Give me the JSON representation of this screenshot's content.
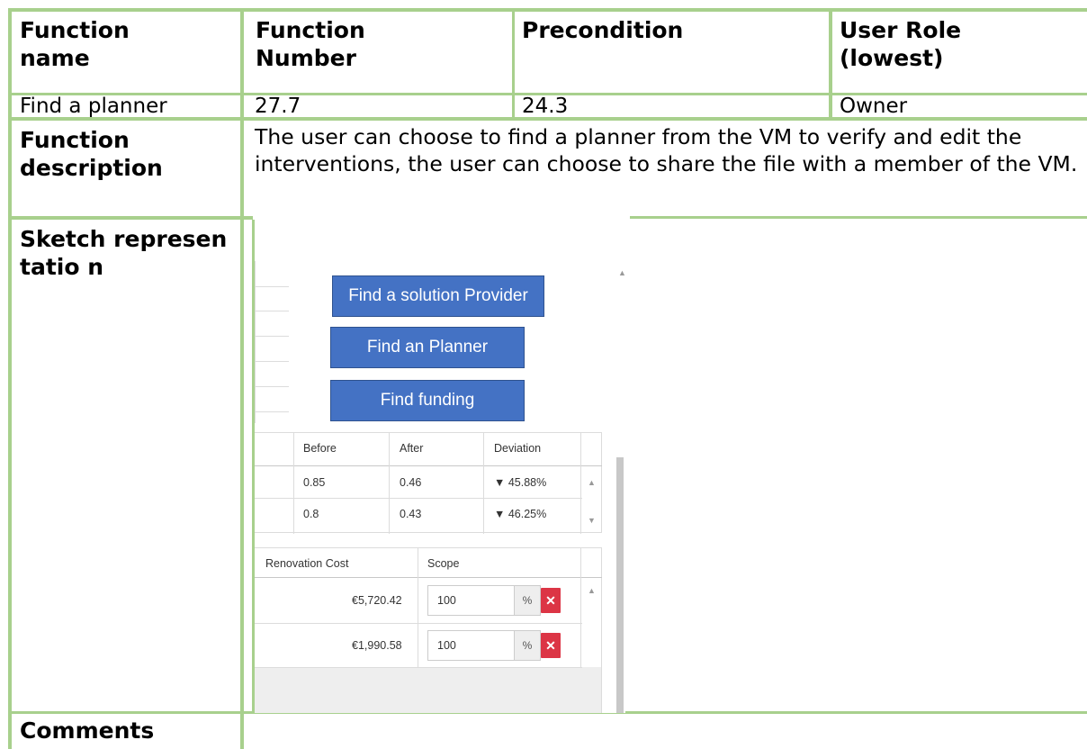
{
  "table": {
    "header": {
      "function_name": "Function name",
      "function_number": "Function Number",
      "precondition": "Precondition",
      "user_role": "User Role (lowest)"
    },
    "row": {
      "function_name": "Find a planner",
      "function_number": "27.7",
      "precondition": "24.3",
      "user_role": "Owner"
    },
    "description_label": "Function description",
    "description_text": "The user can choose to find a planner from the VM to verify and edit the interventions, the user can choose to share the file with a member of the VM.",
    "sketch_label": "Sketch representatio n",
    "comments_label": "Comments"
  },
  "sketch": {
    "buttons": {
      "solution_provider": "Find a solution Provider",
      "planner": "Find an Planner",
      "funding": "Find funding"
    },
    "deviation_table": {
      "headers": [
        "Before",
        "After",
        "Deviation"
      ],
      "rows": [
        {
          "before": "0.85",
          "after": "0.46",
          "deviation": "▼ 45.88%"
        },
        {
          "before": "0.8",
          "after": "0.43",
          "deviation": "▼ 46.25%"
        }
      ]
    },
    "cost_table": {
      "headers": [
        "Renovation Cost",
        "Scope"
      ],
      "rows": [
        {
          "cost": "€5,720.42",
          "scope": "100",
          "unit": "%"
        },
        {
          "cost": "€1,990.58",
          "scope": "100",
          "unit": "%"
        }
      ]
    },
    "colors": {
      "button_blue": "#4472c4",
      "delete_red": "#dc3545",
      "table_border_green": "#a8d08d"
    }
  }
}
